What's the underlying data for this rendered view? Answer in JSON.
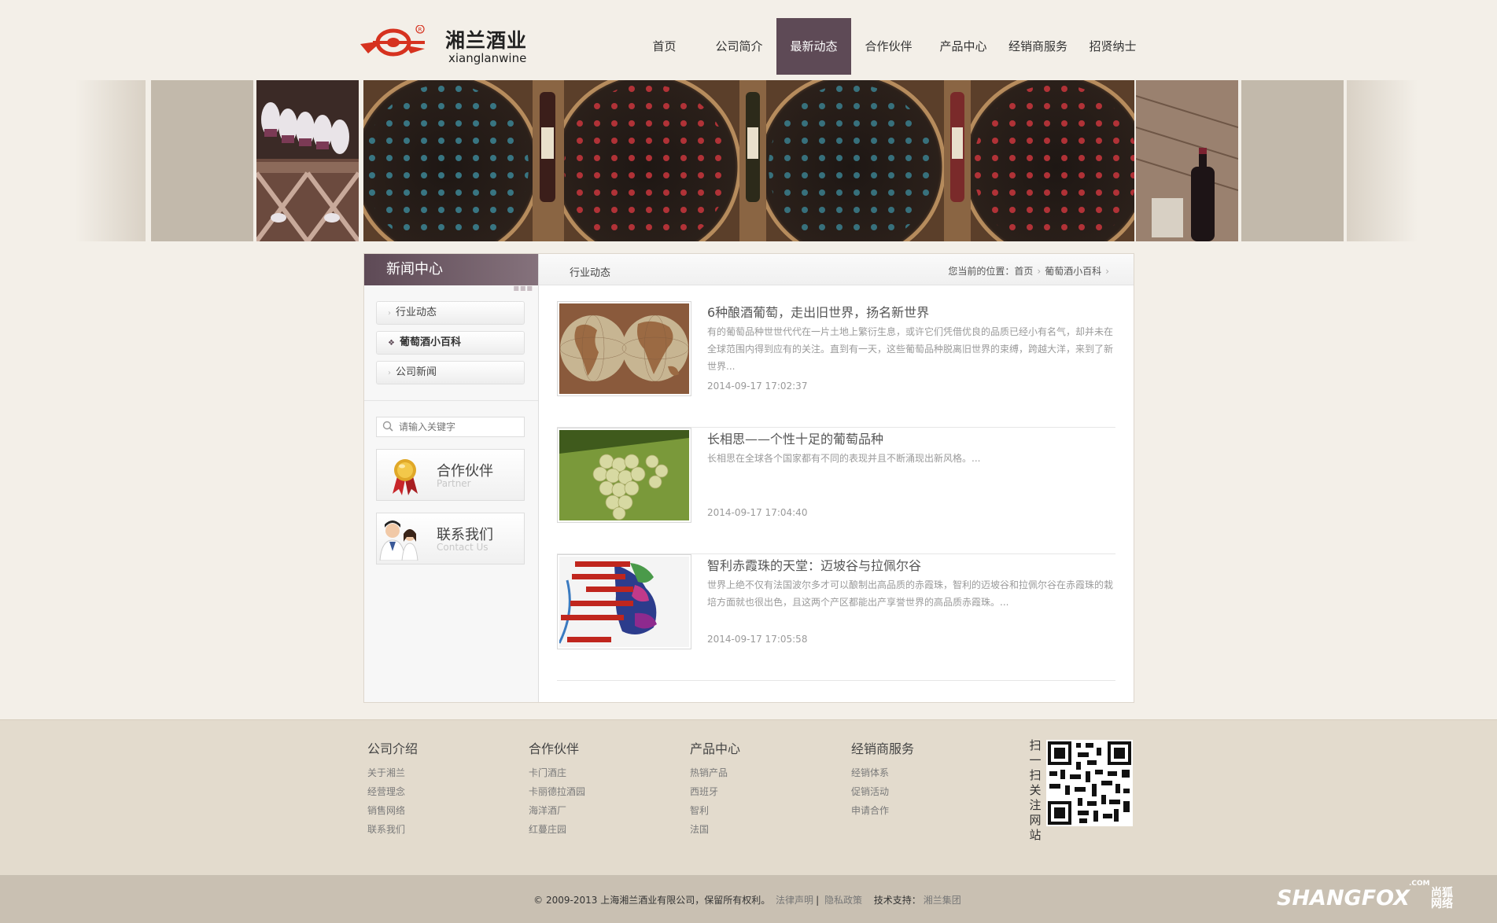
{
  "logo": {
    "name_cn": "湘兰酒业",
    "name_en": "xianglanwine"
  },
  "nav": {
    "items": [
      {
        "label": "首页"
      },
      {
        "label": "公司简介"
      },
      {
        "label": "最新动态"
      },
      {
        "label": "合作伙伴"
      },
      {
        "label": "产品中心"
      },
      {
        "label": "经销商服务"
      },
      {
        "label": "招贤纳士"
      }
    ],
    "active_label": "最新动态"
  },
  "sidebar": {
    "title": "新闻中心",
    "items": [
      {
        "label": "行业动态"
      },
      {
        "label": "葡萄酒小百科"
      },
      {
        "label": "公司新闻"
      }
    ],
    "active_label": "葡萄酒小百科",
    "search_placeholder": "请输入关键字",
    "partner_title": "合作伙伴",
    "partner_sub": "Partner",
    "contact_title": "联系我们",
    "contact_sub": "Contact Us"
  },
  "main": {
    "title": "行业动态",
    "breadcrumb": {
      "prefix": "您当前的位置：",
      "items": [
        "首页",
        "葡萄酒小百科"
      ]
    },
    "news": [
      {
        "title": "6种酿酒葡萄，走出旧世界，扬名新世界",
        "desc": "有的葡萄品种世世代代在一片土地上繁衍生息，或许它们凭借优良的品质已经小有名气，却并未在全球范围内得到应有的关注。直到有一天，这些葡萄品种脱离旧世界的束缚，跨越大洋，来到了新世界...",
        "date": "2014-09-17 17:02:37",
        "image": "world-map-image"
      },
      {
        "title": "长相思——个性十足的葡萄品种",
        "desc": "长相思在全球各个国家都有不同的表现并且不断涌现出新风格。...",
        "date": "2014-09-17 17:04:40",
        "image": "grapes-image"
      },
      {
        "title": "智利赤霞珠的天堂：迈坡谷与拉佩尔谷",
        "desc": "世界上绝不仅有法国波尔多才可以酿制出高品质的赤霞珠，智利的迈坡谷和拉佩尔谷在赤霞珠的栽培方面就也很出色，且这两个产区都能出产享誉世界的高品质赤霞珠。...",
        "date": "2014-09-17 17:05:58",
        "image": "chile-valley-map-image"
      }
    ]
  },
  "footer": {
    "columns": [
      {
        "title": "公司介绍",
        "links": [
          "关于湘兰",
          "经营理念",
          "销售网络",
          "联系我们"
        ]
      },
      {
        "title": "合作伙伴",
        "links": [
          "卡门酒庄",
          "卡丽德拉酒园",
          "海洋酒厂",
          "红蔓庄园"
        ]
      },
      {
        "title": "产品中心",
        "links": [
          "热销产品",
          "西班牙",
          "智利",
          "法国"
        ]
      },
      {
        "title": "经销商服务",
        "links": [
          "经销体系",
          "促销活动",
          "申请合作"
        ]
      }
    ],
    "qr_label": "扫一扫关注网站",
    "copyright": "© 2009-2013 上海湘兰酒业有限公司，保留所有权利。",
    "legal": "法律声明",
    "privacy": "隐私政策",
    "support_label": "技术支持：",
    "support_name": "湘兰集团"
  },
  "watermark": {
    "en": "SHANGFOX",
    "com": ".COM",
    "cn_line1": "尚狐",
    "cn_line2": "网络"
  },
  "colors": {
    "accent": "#5e4a56",
    "footer_bg": "#e3dbcd",
    "bottom_bg": "#c9c0b2",
    "page_bg": "#f3efe8"
  }
}
